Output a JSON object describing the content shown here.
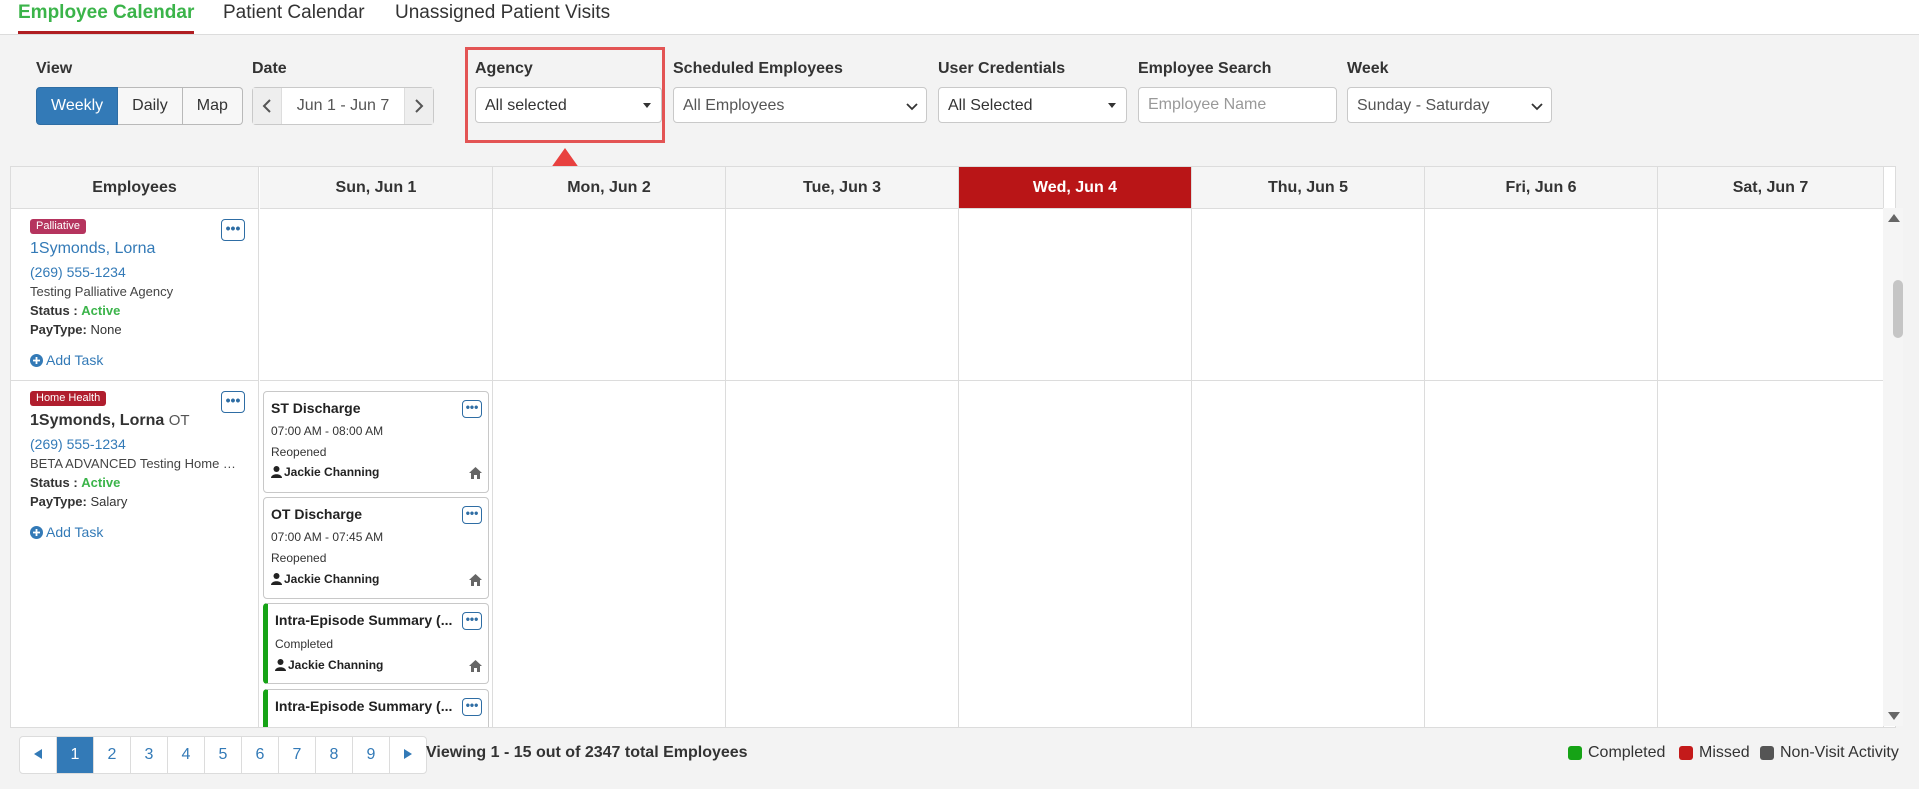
{
  "tabs": [
    "Employee Calendar",
    "Patient Calendar",
    "Unassigned Patient Visits"
  ],
  "filters": {
    "view_label": "View",
    "view_options": [
      "Weekly",
      "Daily",
      "Map"
    ],
    "date_label": "Date",
    "date_value": "Jun 1 - Jun 7",
    "agency_label": "Agency",
    "agency_value": "All selected",
    "scheduled_label": "Scheduled Employees",
    "scheduled_value": "All Employees",
    "credentials_label": "User Credentials",
    "credentials_value": "All Selected",
    "search_label": "Employee Search",
    "search_placeholder": "Employee Name",
    "week_label": "Week",
    "week_value": "Sunday - Saturday"
  },
  "calendar": {
    "employees_header": "Employees",
    "days": [
      "Sun, Jun 1",
      "Mon, Jun 2",
      "Tue, Jun 3",
      "Wed, Jun 4",
      "Thu, Jun 5",
      "Fri, Jun 6",
      "Sat, Jun 7"
    ],
    "today_index": 3,
    "employees": [
      {
        "badge": "Palliative",
        "badge_color": "#b5345e",
        "name": "1Symonds, Lorna",
        "credential": "",
        "phone": "(269) 555-1234",
        "agency": "Testing Palliative Agency",
        "status_label": "Status :",
        "status": "Active",
        "paytype_label": "PayType:",
        "paytype": "None",
        "add_task": "Add Task"
      },
      {
        "badge": "Home Health",
        "badge_color": "#b01e2e",
        "name": "1Symonds, Lorna",
        "credential": "OT",
        "phone": "(269) 555-1234",
        "agency": "BETA ADVANCED Testing Home H...",
        "status_label": "Status :",
        "status": "Active",
        "paytype_label": "PayType:",
        "paytype": "Salary",
        "add_task": "Add Task"
      }
    ],
    "tasks": [
      {
        "title": "ST Discharge",
        "time": "07:00 AM - 08:00 AM",
        "status": "Reopened",
        "employee": "Jackie Channing"
      },
      {
        "title": "OT Discharge",
        "time": "07:00 AM - 07:45 AM",
        "status": "Reopened",
        "employee": "Jackie Channing"
      },
      {
        "title": "Intra-Episode Summary (...",
        "status": "Completed",
        "employee": "Jackie Channing"
      },
      {
        "title": "Intra-Episode Summary (..."
      }
    ]
  },
  "pagination": {
    "pages": [
      "1",
      "2",
      "3",
      "4",
      "5",
      "6",
      "7",
      "8",
      "9"
    ],
    "current": "1",
    "viewing_text": "Viewing 1 - 15 out of 2347 total Employees"
  },
  "legend": [
    {
      "label": "Completed",
      "color": "#16a316"
    },
    {
      "label": "Missed",
      "color": "#c41a1a"
    },
    {
      "label": "Non-Visit Activity",
      "color": "#555555"
    }
  ],
  "more_glyph": "•••"
}
